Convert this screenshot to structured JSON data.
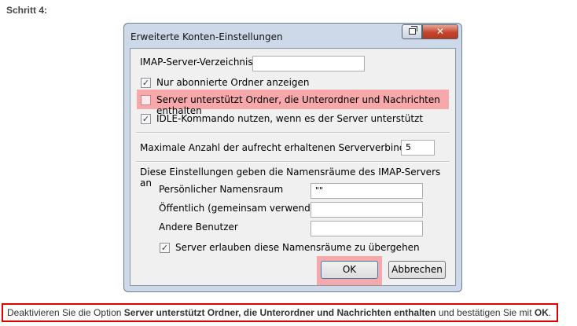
{
  "step": {
    "heading": "Schritt 4:"
  },
  "dialog": {
    "title": "Erweiterte Konten-Einstellungen",
    "close_glyph": "✕",
    "imap_dir_label": "IMAP-Server-Verzeichnis:",
    "imap_dir_value": "",
    "checkbox_subscribed": {
      "label": "Nur abonnierte Ordner anzeigen",
      "checked": true
    },
    "checkbox_folders": {
      "label": "Server unterstützt Ordner, die Unterordner und Nachrichten enthalten",
      "checked": false
    },
    "checkbox_idle": {
      "label": "IDLE-Kommando nutzen, wenn es der Server unterstützt",
      "checked": true
    },
    "max_conn_label": "Maximale Anzahl der aufrecht erhaltenen Serververbindungen",
    "max_conn_value": "5",
    "ns_heading": "Diese Einstellungen geben die Namensräume des IMAP-Servers an",
    "ns_personal_label": "Persönlicher Namensraum",
    "ns_personal_value": "\"\"",
    "ns_public_label": "Öffentlich (gemeinsam verwendet)",
    "ns_public_value": "",
    "ns_other_label": "Andere Benutzer",
    "ns_other_value": "",
    "checkbox_override": {
      "label": "Server erlauben diese Namensräume zu übergehen",
      "checked": true
    },
    "ok_label": "OK",
    "cancel_label": "Abbrechen",
    "check_glyph": "✓"
  },
  "caption": {
    "prefix": "Deaktivieren Sie die Option ",
    "option": "Server unterstützt Ordner, die Unterordner und Nachrichten enthalten",
    "middle": " und bestätigen Sie mit ",
    "button": "OK",
    "suffix": "."
  },
  "colors": {
    "highlight": "#f6a8aa",
    "caption_border": "#e00000",
    "close_button": "#c3462c"
  }
}
